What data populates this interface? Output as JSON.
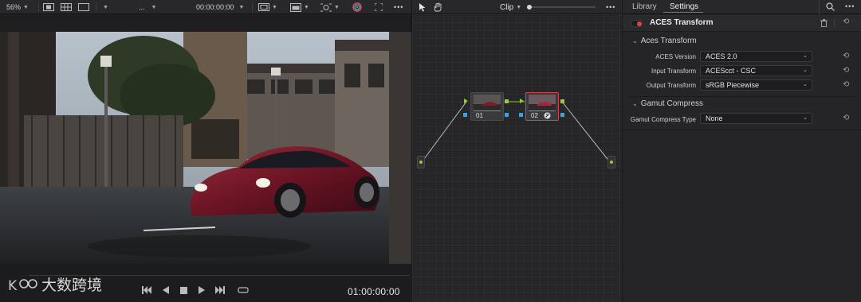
{
  "viewer": {
    "zoom": "56%",
    "zoom_chev": "⌄",
    "clip_menu": "...",
    "header_timecode": "00:00:00:00",
    "timecode": "01:00:00:00"
  },
  "node_editor": {
    "mode_label": "Clip",
    "more": "•••",
    "nodes": [
      {
        "label": "01"
      },
      {
        "label": "02"
      }
    ]
  },
  "inspector": {
    "tabs": [
      "Library",
      "Settings"
    ],
    "active_tab": "Settings",
    "effect_title": "ACES Transform",
    "more": "•••",
    "sections": [
      {
        "title": "Aces Transform",
        "rows": [
          {
            "label": "ACES Version",
            "value": "ACES 2.0"
          },
          {
            "label": "Input Transform",
            "value": "ACEScct - CSC"
          },
          {
            "label": "Output Transform",
            "value": "sRGB Piecewise"
          }
        ]
      },
      {
        "title": "Gamut Compress",
        "rows": [
          {
            "label": "Gamut Compress Type",
            "value": "None"
          }
        ]
      }
    ]
  },
  "colors": {
    "accent_red": "#d24a4a",
    "node_port_green": "#9acd32",
    "node_port_blue": "#3ba3e0",
    "panel_bg": "#252527"
  },
  "watermark": "大数跨境"
}
